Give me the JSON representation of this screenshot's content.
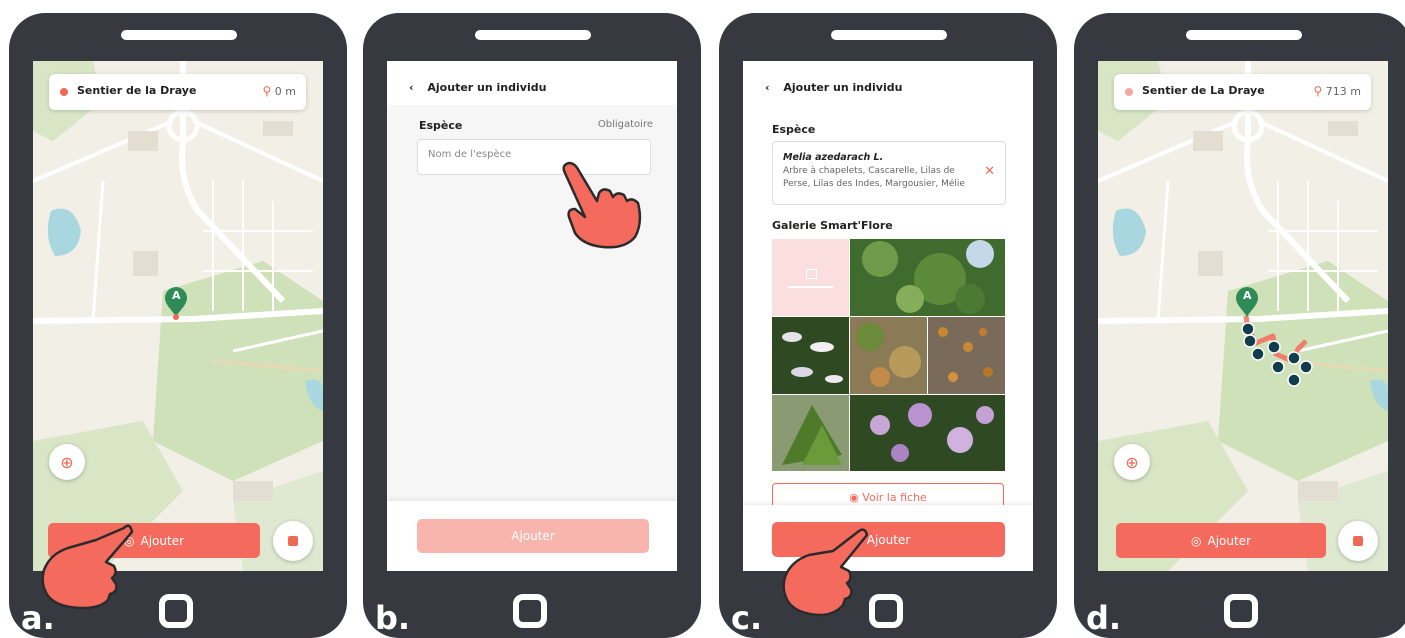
{
  "colors": {
    "accent": "#f46b5e",
    "accent_disabled": "#f8b5ae",
    "phone": "#363a40",
    "map_bg": "#f1efe6",
    "park": "#cfe1b9",
    "water": "#a9d7df",
    "road": "#ffffff",
    "marker": "#2e8b57",
    "trail_point": "#123d4c"
  },
  "panels": [
    {
      "step": "a.",
      "trail_name": "Sentier de la Draye",
      "distance": "0 m",
      "marker_label": "A",
      "add_label": "Ajouter"
    },
    {
      "step": "b.",
      "title": "Ajouter un individu",
      "species_label": "Espèce",
      "required_label": "Obligatoire",
      "species_placeholder": "Nom de l'espèce",
      "add_label": "Ajouter"
    },
    {
      "step": "c.",
      "title": "Ajouter un individu",
      "species_label": "Espèce",
      "species_name": "Melia azedarach L.",
      "species_common_1": "Arbre à chapelets, Cascarelle, Lilas de",
      "species_common_2": "Perse, Lilas des Indes, Margousier, Mélie",
      "gallery_label": "Galerie Smart'Flore",
      "view_label": "Voir la fiche",
      "add_label": "Ajouter"
    },
    {
      "step": "d.",
      "trail_name": "Sentier de La Draye",
      "distance": "713 m",
      "marker_label": "A",
      "add_label": "Ajouter"
    }
  ],
  "icons": {
    "back": "chevron-left-icon",
    "distance": "route-pin-icon",
    "locate": "crosshair-icon",
    "stop": "stop-icon",
    "add": "location-pin-icon",
    "clear": "close-icon",
    "eye": "eye-icon",
    "gallery_placeholder": "image-icon"
  }
}
